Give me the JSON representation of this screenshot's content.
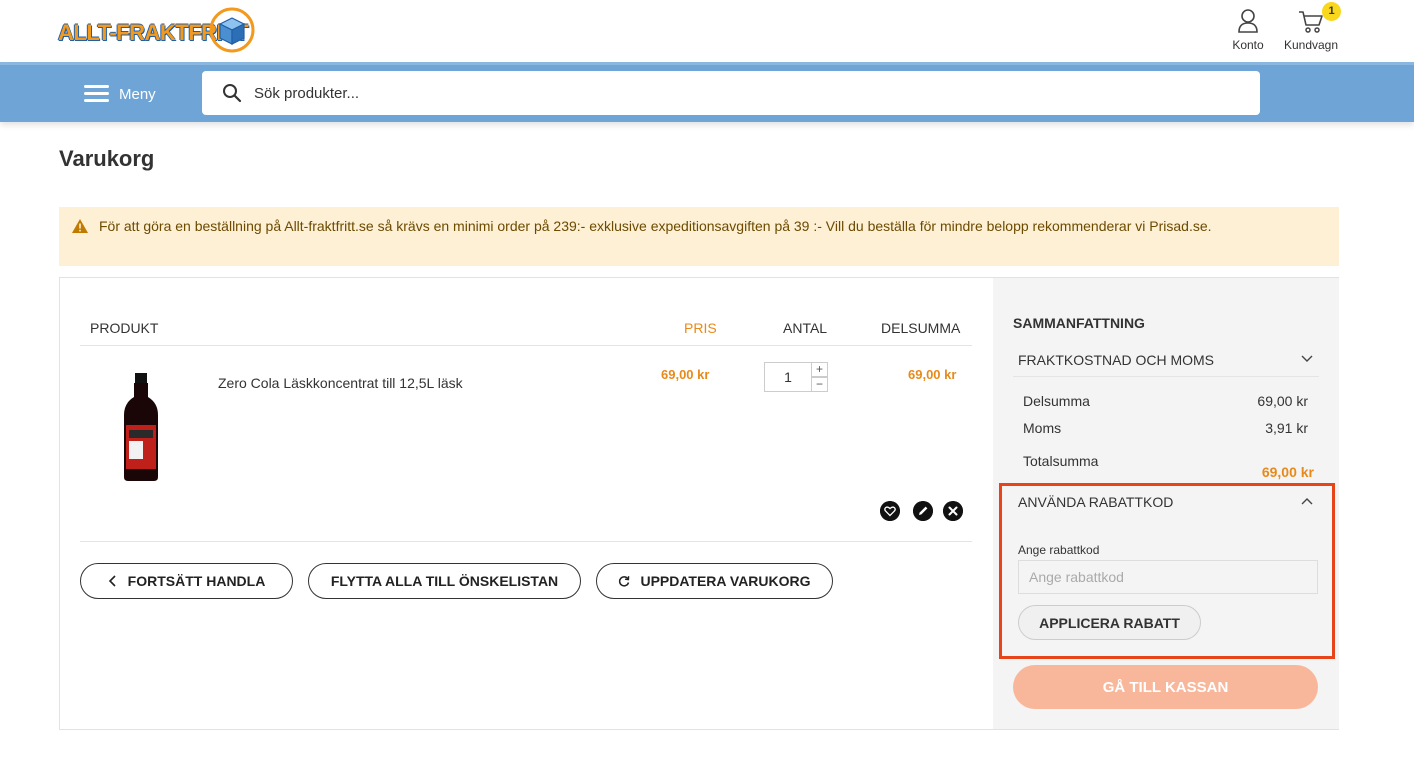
{
  "header": {
    "logo_text": "ALLT-FRAKTFRITT",
    "account_label": "Konto",
    "cart_label": "Kundvagn",
    "cart_count": "1"
  },
  "nav": {
    "menu_label": "Meny",
    "search_placeholder": "Sök produkter..."
  },
  "page": {
    "title": "Varukorg",
    "notice": "För att göra en beställning på Allt-fraktfritt.se så krävs en minimi order på 239:- exklusive expeditionsavgiften på 39 :- Vill du beställa för mindre belopp rekommenderar vi Prisad.se."
  },
  "table": {
    "headers": {
      "product": "PRODUKT",
      "price": "PRIS",
      "qty": "ANTAL",
      "subtotal": "DELSUMMA"
    },
    "items": [
      {
        "name": "Zero Cola Läskkoncentrat till 12,5L läsk",
        "price": "69,00 kr",
        "qty": "1",
        "subtotal": "69,00 kr"
      }
    ]
  },
  "actions": {
    "continue": "FORTSÄTT HANDLA",
    "move_wishlist": "FLYTTA ALLA TILL ÖNSKELISTAN",
    "update_cart": "UPPDATERA VARUKORG"
  },
  "summary": {
    "title": "SAMMANFATTNING",
    "shipping_header": "FRAKTKOSTNAD OCH MOMS",
    "subtotal_label": "Delsumma",
    "subtotal_value": "69,00 kr",
    "vat_label": "Moms",
    "vat_value": "3,91 kr",
    "total_label": "Totalsumma",
    "total_value": "69,00 kr",
    "discount_header": "ANVÄNDA RABATTKOD",
    "discount_label": "Ange rabattkod",
    "discount_placeholder": "Ange rabattkod",
    "apply_label": "APPLICERA RABATT",
    "checkout_label": "GÅ TILL KASSAN"
  },
  "colors": {
    "nav_blue": "#6fa5d6",
    "accent_orange": "#e88a1a",
    "checkout_salmon": "#f8b79b",
    "highlight_red": "#e8441a",
    "notice_bg": "#fdf0d5"
  }
}
